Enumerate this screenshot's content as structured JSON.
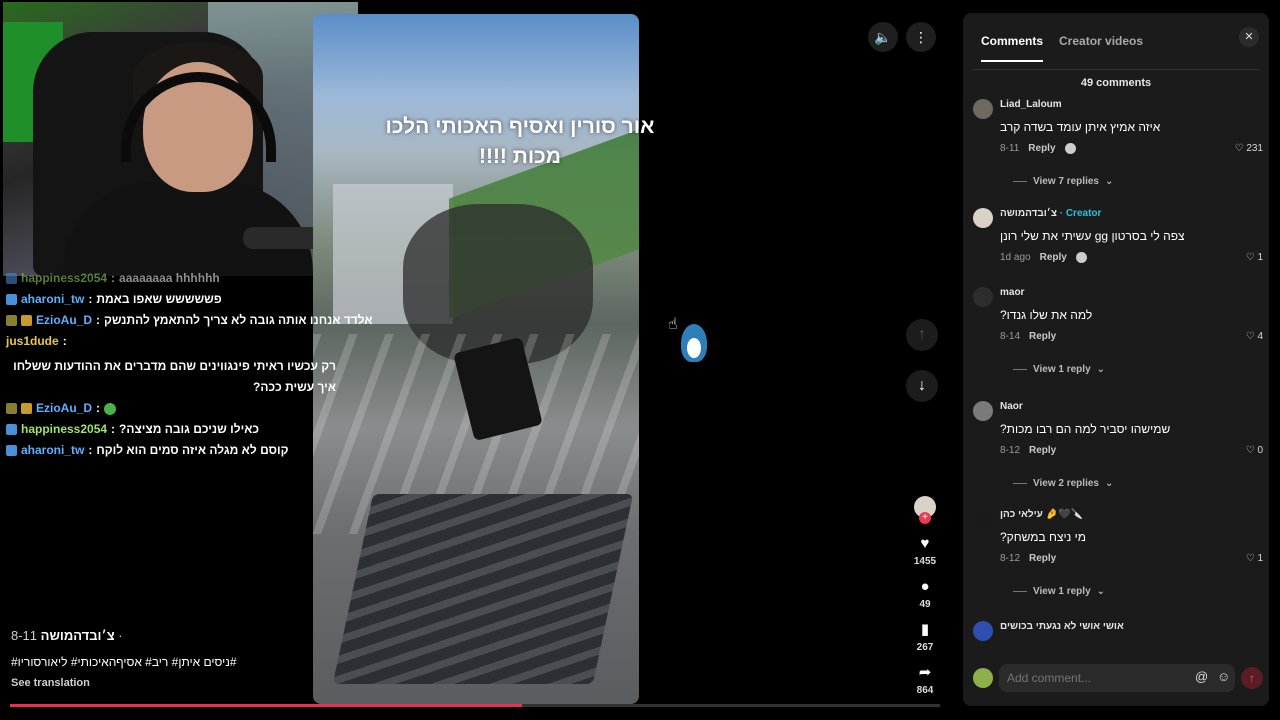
{
  "chat": [
    {
      "user": "happiness2054",
      "msg": "aaaaaaaa hhhhhh",
      "color": "green",
      "badge": "blue",
      "faded": true
    },
    {
      "user": "aharoni_tw",
      "msg": "פששששש שאפו באמת",
      "color": "blue2",
      "badge": "blue"
    },
    {
      "user": "EzioAu_D",
      "msg": "אלדד אנחנו אותה גובה לא צריך להתאמץ להתנשק",
      "color": "blue2",
      "badge": "mod"
    },
    {
      "user": "jus1dude",
      "msg": "רק עכשיו ראיתי פינגווינים שהם מדברים את ההודעות ששלחו איך עשית ככה?",
      "color": "gold",
      "badge": ""
    },
    {
      "user": "EzioAu_D",
      "msg": "",
      "color": "blue2",
      "badge": "mod",
      "emoji": true
    },
    {
      "user": "happiness2054",
      "msg": "כאילו שניכם גובה מציצה?",
      "color": "green",
      "badge": "blue"
    },
    {
      "user": "aharoni_tw",
      "msg": "קוסם לא מגלה איזה סמים הוא לוקח",
      "color": "blue2",
      "badge": "blue"
    }
  ],
  "video": {
    "caption_line1": "אור סורין ואסיף האכותי הלכו",
    "caption_line2": "מכות !!!!"
  },
  "post": {
    "author": "צ׳ובדהמושה",
    "date": "8-11 ·",
    "tags": "#ניסים איתן# ריב# אסיףהאיכותי# ליאורסוריו#",
    "see_translation": "See translation",
    "progress": 0.55
  },
  "actions": {
    "likes": "1455",
    "comments": "49",
    "saves": "267",
    "shares": "864"
  },
  "panel": {
    "tab_comments": "Comments",
    "tab_creator": "Creator videos",
    "count": "49 comments",
    "comments": [
      {
        "name": "Liad_Laloum",
        "text": "איזה אמיץ איתן עומד בשדה קרב",
        "date": "8-11",
        "likes": "231",
        "replies": "View 7 replies",
        "creator": false
      },
      {
        "name": "צ׳ובדהמושה",
        "creator_label": "· Creator",
        "text": "צפה לי בסרטון gg עשיתי את שלי רונן",
        "date": "1d ago",
        "likes": "1",
        "replies": "",
        "creator": true
      },
      {
        "name": "maor",
        "text": "למה את שלו גנדו?",
        "date": "8-14",
        "likes": "4",
        "replies": "View 1 reply",
        "creator": false
      },
      {
        "name": "Naor",
        "text": "שמישהו יסביר למה הם רבו מכות?",
        "date": "8-12",
        "likes": "0",
        "replies": "View 2 replies",
        "creator": false
      },
      {
        "name": "עילאי כהן 🤌🖤🔪",
        "text": "מי ניצח במשחק?",
        "date": "8-12",
        "likes": "1",
        "replies": "View 1 reply",
        "creator": false
      }
    ],
    "partial_comment": "אושי אושי לא נגעתי בכושים",
    "reply_label": "Reply",
    "add_placeholder": "Add comment...",
    "at_symbol": "@",
    "emoji_symbol": "☺"
  }
}
